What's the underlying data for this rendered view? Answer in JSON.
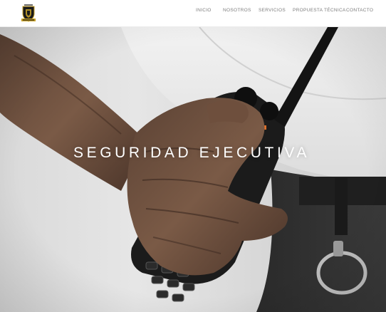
{
  "header": {
    "logo_icon": "shield-crest-logo",
    "logo_colors": {
      "shield": "#1c1c1c",
      "gold": "#c9a227"
    }
  },
  "nav": {
    "items": [
      {
        "label": "INICIO"
      },
      {
        "label": "NOSOTROS"
      },
      {
        "label": "SERVICIOS"
      },
      {
        "label": "PROPUESTA TÉCNICA"
      },
      {
        "label": "CONTACTO"
      }
    ]
  },
  "hero": {
    "title": "SEGURIDAD EJECUTIVA",
    "image_subject": "hand-holding-radio"
  }
}
